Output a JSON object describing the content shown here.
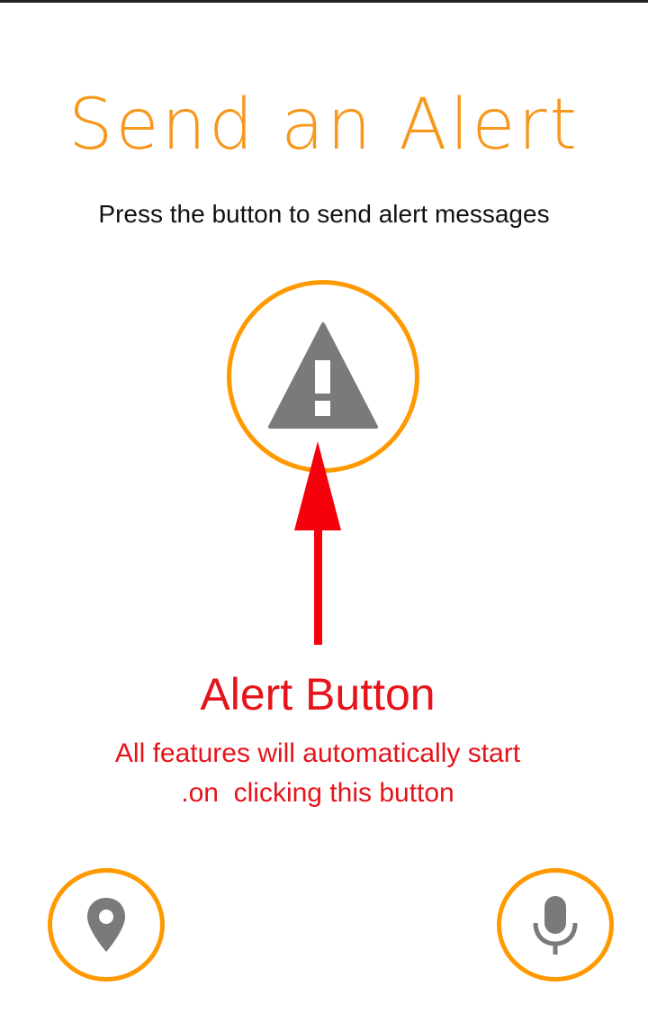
{
  "screen": {
    "title": "Send an Alert",
    "subtitle": "Press the button to send alert messages"
  },
  "buttons": {
    "alert": {
      "icon": "warning-triangle-icon"
    },
    "location": {
      "icon": "location-pin-icon"
    },
    "microphone": {
      "icon": "microphone-icon"
    }
  },
  "annotation": {
    "title": "Alert Button",
    "line1": "All features will automatically start",
    "line2": ".on  clicking this button"
  },
  "colors": {
    "accent": "#f7981d",
    "button_ring": "#ff9900",
    "icon_gray": "#7a7a7a",
    "annotation_red": "#e5141b"
  }
}
